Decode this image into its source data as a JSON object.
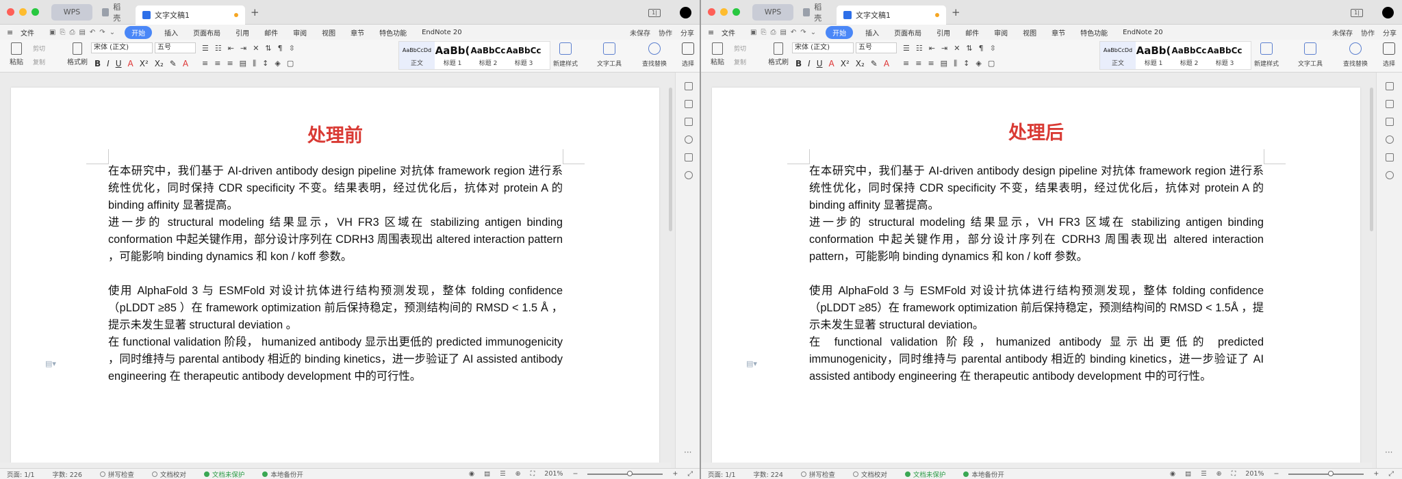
{
  "windows": [
    {
      "tabs": {
        "home": "WPS",
        "shell": "稻壳",
        "doc": "文字文稿1"
      },
      "menu": {
        "file": "文件",
        "items": [
          "开始",
          "插入",
          "页面布局",
          "引用",
          "邮件",
          "审阅",
          "视图",
          "章节",
          "特色功能",
          "EndNote 20"
        ],
        "right": [
          "未保存",
          "协作",
          "分享"
        ]
      },
      "ribbon": {
        "paste": "粘贴",
        "cut": "剪切",
        "copy": "复制",
        "format_painter": "格式刷",
        "font": "宋体 (正文)",
        "size": "五号",
        "styles": [
          {
            "preview": "AaBbCcDd",
            "label": "正文"
          },
          {
            "preview": "AaBb(",
            "label": "标题 1"
          },
          {
            "preview": "AaBbCc",
            "label": "标题 2"
          },
          {
            "preview": "AaBbCc",
            "label": "标题 3"
          }
        ],
        "new_style": "新建样式",
        "text_tools": "文字工具",
        "find_replace": "查找替换",
        "select": "选择"
      },
      "doc": {
        "title": "处理前",
        "paragraphs": [
          "在本研究中，我们基于 AI-driven antibody design pipeline  对抗体 framework region  进行系统性优化，同时保持 CDR specificity  不变。结果表明，经过优化后，抗体对 protein A  的 binding affinity  显著提高。",
          "进一步的 structural modeling  结果显示，VH FR3  区域在 stabilizing antigen binding conformation  中起关键作用，部分设计序列在 CDRH3  周围表现出 altered interaction pattern  ，可能影响 binding dynamics  和 kon / koff  参数。",
          "",
          "使用 AlphaFold 3  与 ESMFold  对设计抗体进行结构预测发现，整体 folding confidence （pLDDT ≥85 ）在 framework optimization  前后保持稳定，预测结构间的 RMSD < 1.5 Å ，提示未发生显著 structural deviation  。",
          "在 functional validation  阶段， humanized antibody  显示出更低的 predicted immunogenicity ，同时维持与 parental antibody  相近的 binding kinetics，进一步验证了 AI assisted antibody engineering  在 therapeutic antibody development  中的可行性。"
        ]
      },
      "status": {
        "page": "页面: 1/1",
        "words": "字数: 226",
        "spell": "拼写检查",
        "proof": "文档校对",
        "protect": "文档未保护",
        "backup": "本地备份开",
        "zoom": "201%"
      }
    },
    {
      "tabs": {
        "home": "WPS",
        "shell": "稻壳",
        "doc": "文字文稿1"
      },
      "menu": {
        "file": "文件",
        "items": [
          "开始",
          "插入",
          "页面布局",
          "引用",
          "邮件",
          "审阅",
          "视图",
          "章节",
          "特色功能",
          "EndNote 20"
        ],
        "right": [
          "未保存",
          "协作",
          "分享"
        ]
      },
      "ribbon": {
        "paste": "粘贴",
        "cut": "剪切",
        "copy": "复制",
        "format_painter": "格式刷",
        "font": "宋体 (正文)",
        "size": "五号",
        "styles": [
          {
            "preview": "AaBbCcDd",
            "label": "正文"
          },
          {
            "preview": "AaBb(",
            "label": "标题 1"
          },
          {
            "preview": "AaBbCc",
            "label": "标题 2"
          },
          {
            "preview": "AaBbCc",
            "label": "标题 3"
          }
        ],
        "new_style": "新建样式",
        "text_tools": "文字工具",
        "find_replace": "查找替换",
        "select": "选择"
      },
      "doc": {
        "title": "处理后",
        "paragraphs": [
          "在本研究中，我们基于 AI-driven antibody design pipeline 对抗体 framework region 进行系统性优化，同时保持 CDR specificity 不变，结果表明，经过优化后，抗体对 protein A 的 binding affinity 显著提高。",
          "进一步的 structural modeling 结果显示，VH FR3 区域在 stabilizing antigen binding conformation 中起关键作用，部分设计序列在 CDRH3 周围表现出 altered interaction pattern，可能影响 binding dynamics 和 kon / koff 参数。",
          "",
          "使用 AlphaFold 3 与 ESMFold 对设计抗体进行结构预测发现，整体 folding confidence（pLDDT ≥85）在 framework optimization 前后保持稳定，预测结构间的 RMSD < 1.5Å ，提示未发生显著 structural deviation。",
          "在 functional validation 阶段，humanized antibody 显示出更低的 predicted immunogenicity，同时维持与 parental antibody 相近的 binding kinetics，进一步验证了 AI assisted antibody engineering 在 therapeutic antibody development 中的可行性。"
        ]
      },
      "status": {
        "page": "页面: 1/1",
        "words": "字数: 224",
        "spell": "拼写检查",
        "proof": "文档校对",
        "protect": "文档未保护",
        "backup": "本地备份开",
        "zoom": "201%"
      }
    }
  ],
  "colors": {
    "accent": "#4a87f7",
    "title_red": "#d93a34",
    "status_green": "#3aa753"
  }
}
